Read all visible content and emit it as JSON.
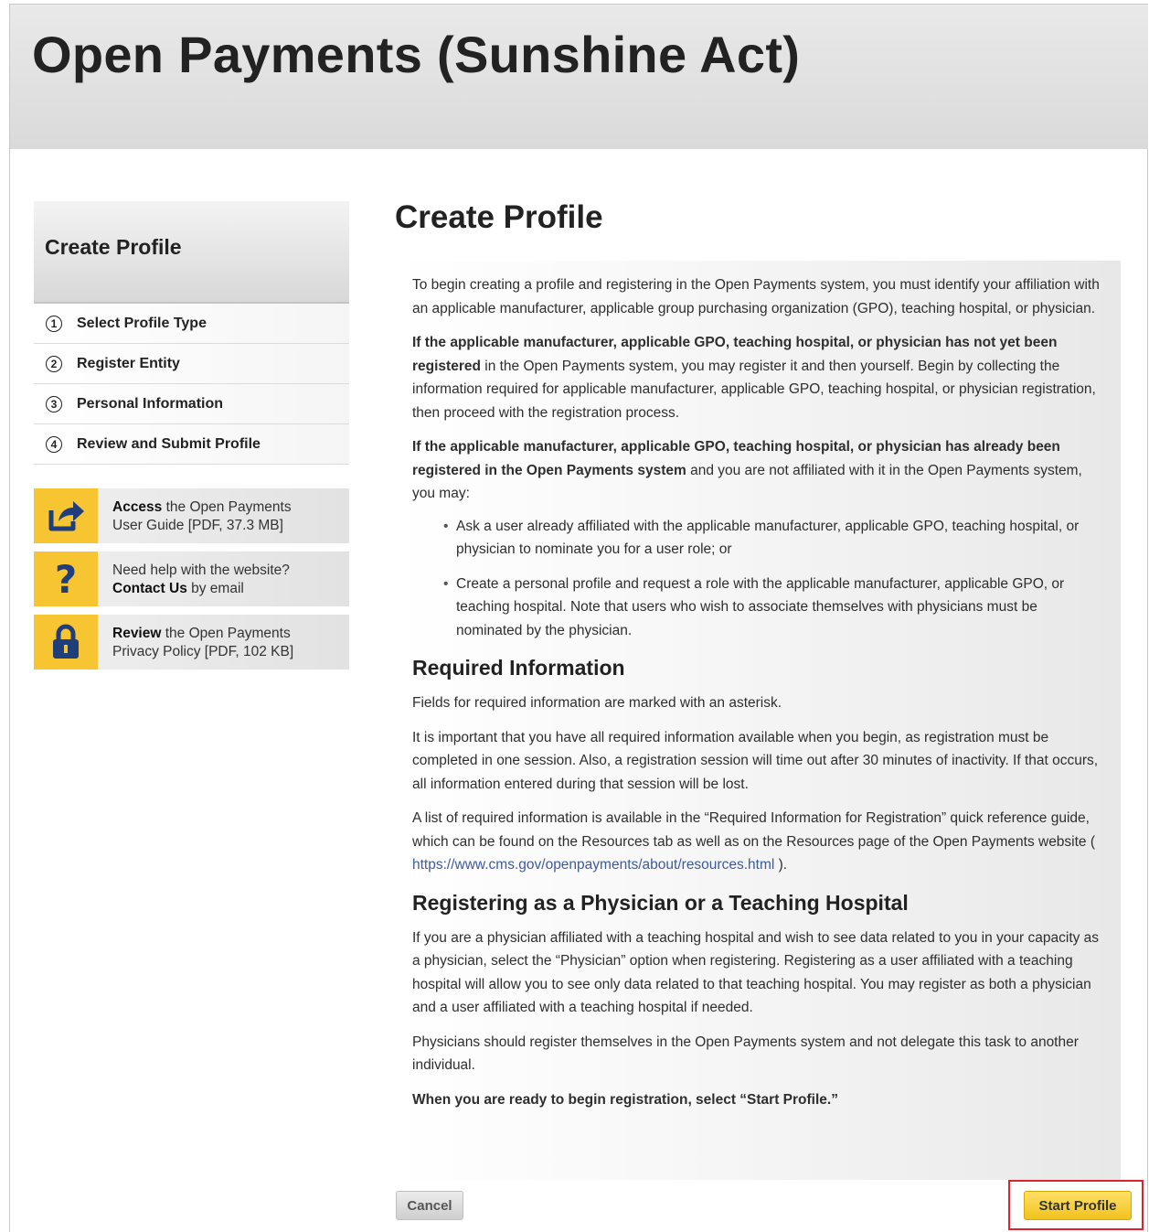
{
  "banner": {
    "title": "Open Payments (Sunshine Act)"
  },
  "sidebar": {
    "title": "Create Profile",
    "steps": [
      {
        "num": "1",
        "label": "Select Profile Type"
      },
      {
        "num": "2",
        "label": "Register Entity"
      },
      {
        "num": "3",
        "label": "Personal Information"
      },
      {
        "num": "4",
        "label": "Review and Submit Profile"
      }
    ],
    "tiles": [
      {
        "icon": "share-arrow-icon",
        "bold": "Access",
        "line1_rest": " the Open Payments",
        "line2": "User Guide [PDF, 37.3 MB]"
      },
      {
        "icon": "question-mark-icon",
        "line1": "Need help with the website?",
        "bold": "Contact Us",
        "line2_rest": " by email"
      },
      {
        "icon": "lock-icon",
        "bold": "Review",
        "line1_rest": " the Open Payments",
        "line2": "Privacy Policy [PDF, 102 KB]"
      }
    ]
  },
  "main": {
    "title": "Create Profile",
    "intro": "To begin creating a profile and registering in the Open Payments system, you must identify your affiliation with an applicable manufacturer, applicable group purchasing organization (GPO), teaching hospital, or physician.",
    "not_registered_bold": "If the applicable manufacturer, applicable GPO, teaching hospital, or physician has not yet been registered",
    "not_registered_rest": " in the Open Payments system, you may register it and then yourself. Begin by collecting the information required for applicable manufacturer, applicable GPO, teaching hospital, or physician registration, then proceed with the registration process.",
    "already_registered_bold": "If the applicable manufacturer, applicable GPO, teaching hospital, or physician has already been registered in the Open Payments system",
    "already_registered_rest": " and you are not affiliated with it in the Open Payments system, you may:",
    "bullets": [
      "Ask a user already affiliated with the applicable manufacturer, applicable GPO, teaching hospital, or physician to nominate you for a user role; or",
      "Create a personal profile and request a role with the applicable manufacturer, applicable GPO, or teaching hospital. Note that users who wish to associate themselves with physicians must be nominated by the physician."
    ],
    "required_heading": "Required Information",
    "required_p1": "Fields for required information are marked with an asterisk.",
    "required_p2": "It is important that you have all required information available when you begin, as registration must be completed in one session. Also, a registration session will time out after 30 minutes of inactivity. If that occurs, all information entered during that session will be lost.",
    "required_p3_a": "A list of required information is available in the “Required Information for Registration” quick reference guide, which can be found on the Resources tab as well as on the Resources page of the Open Payments website ( ",
    "required_p3_link": "https://www.cms.gov/openpayments/about/resources.html",
    "required_p3_b": " ).",
    "physician_heading": "Registering as a Physician or a Teaching Hospital",
    "physician_p1": "If you are a physician affiliated with a teaching hospital and wish to see data related to you in your capacity as a physician, select the “Physician” option when registering. Registering as a user affiliated with a teaching hospital will allow you to see only data related to that teaching hospital. You may register as both a physician and a user affiliated with a teaching hospital if needed.",
    "physician_p2": "Physicians should register themselves in the Open Payments system and not delegate this task to another individual.",
    "ready_text": "When you are ready to begin registration, select “Start Profile.”"
  },
  "buttons": {
    "cancel": "Cancel",
    "start": "Start Profile"
  },
  "colors": {
    "accent_yellow": "#f6c531",
    "icon_blue": "#1f3e7a",
    "highlight_red": "#d9262e",
    "link": "#3d5a9e"
  }
}
